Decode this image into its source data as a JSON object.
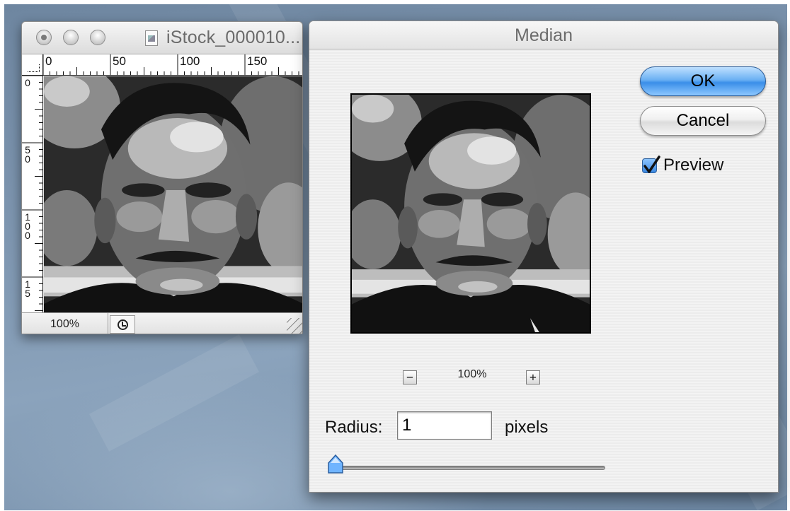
{
  "document_window": {
    "title": "iStock_000010...",
    "ruler_h_labels": [
      "0",
      "50",
      "100",
      "150"
    ],
    "ruler_v_labels": [
      "0",
      "5\n0",
      "1\n0\n0",
      "1\n5"
    ],
    "zoom": "100%",
    "icons": [
      "close-icon",
      "minimize-icon",
      "zoom-icon",
      "document-proxy-icon",
      "clock-icon",
      "resize-grip-icon"
    ]
  },
  "dialog": {
    "title": "Median",
    "ok_label": "OK",
    "cancel_label": "Cancel",
    "preview_checked": true,
    "preview_label": "Preview",
    "zoom_out": "−",
    "zoom_in": "+",
    "zoom_level": "100%",
    "radius_label": "Radius:",
    "radius_value": "1",
    "radius_unit": "pixels",
    "radius_slider_fraction": 0.0
  },
  "colors": {
    "ok_button": "#3a8ee8",
    "desktop": "#7f97b1"
  }
}
